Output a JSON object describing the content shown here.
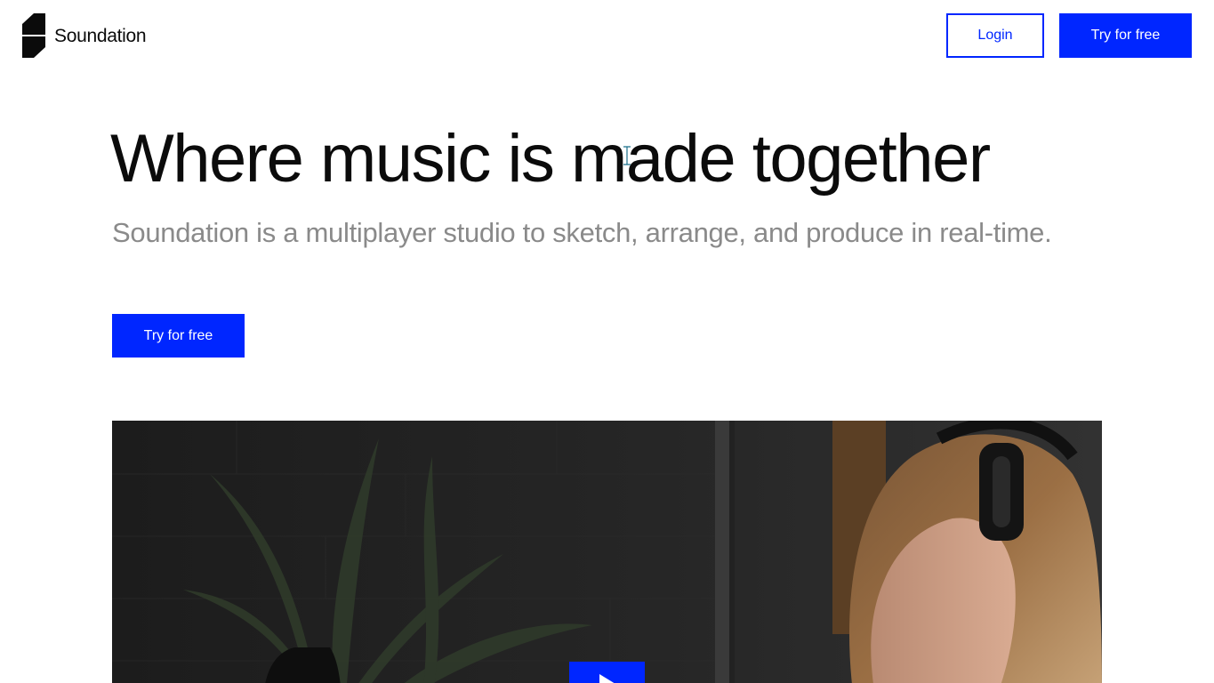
{
  "header": {
    "brand_name": "Soundation",
    "login_label": "Login",
    "try_label": "Try for free"
  },
  "hero": {
    "title": "Where music is made together",
    "subtitle": "Soundation is a multiplayer studio to sketch, arrange, and produce in real-time.",
    "cta_label": "Try for free"
  },
  "video": {
    "play_icon": "play-icon"
  },
  "colors": {
    "accent": "#0026ff",
    "text": "#0b0b0b",
    "subtitle": "#8a8a8a",
    "background": "#ffffff"
  }
}
